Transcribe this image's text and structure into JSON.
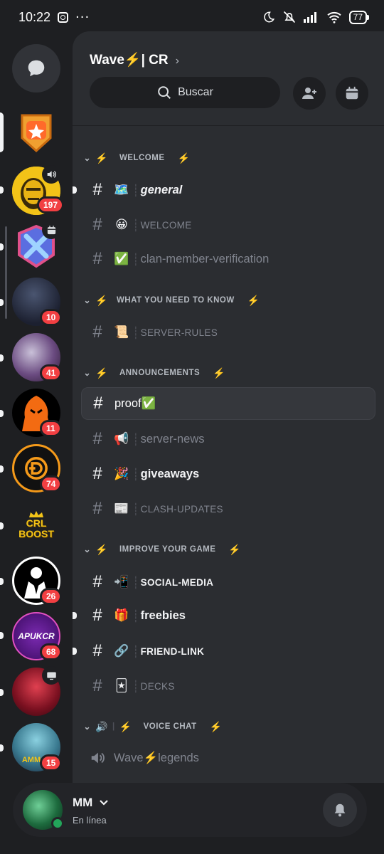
{
  "status_bar": {
    "time": "10:22",
    "more": "···",
    "battery": "77"
  },
  "servers": [
    {
      "kind": "dm",
      "icon": "messages-icon"
    },
    {
      "kind": "server",
      "badge": "",
      "active": true
    },
    {
      "kind": "server",
      "badge": "197",
      "voice": true
    },
    {
      "kind": "server",
      "badge": "",
      "event": true
    },
    {
      "kind": "server",
      "badge": "10"
    },
    {
      "kind": "server",
      "badge": "41"
    },
    {
      "kind": "server",
      "badge": "11"
    },
    {
      "kind": "server",
      "badge": "74"
    },
    {
      "kind": "server",
      "badge": "",
      "logo_text": "CRL BOOST"
    },
    {
      "kind": "server",
      "badge": "26"
    },
    {
      "kind": "server",
      "badge": "68",
      "logo_text": "APUKCR"
    },
    {
      "kind": "server",
      "badge": "",
      "screen": true
    },
    {
      "kind": "server",
      "badge": "15",
      "logo_text": "AMM"
    }
  ],
  "header": {
    "server_name": "Wave⚡| CR",
    "search_label": "Buscar"
  },
  "categories": {
    "welcome": "WELCOME",
    "need_to_know": "WHAT YOU NEED TO KNOW",
    "announcements": "ANNOUNCEMENTS",
    "improve": "IMPROVE YOUR GAME",
    "voice": "VOICE CHAT"
  },
  "channels": {
    "general": {
      "emoji": "🗺️",
      "name": "general"
    },
    "welcome": {
      "emoji": "😀",
      "name": "WELCOME"
    },
    "verification": {
      "emoji": "✅",
      "name": "clan-member-verification"
    },
    "rules": {
      "emoji": "📜",
      "name": "SERVER-RULES"
    },
    "proof": {
      "name": "proof✅"
    },
    "news": {
      "emoji": "📢",
      "name": "server-news"
    },
    "giveaways": {
      "emoji": "🎉",
      "name": "giveaways"
    },
    "clash_updates": {
      "emoji": "📰",
      "name": "CLASH-UPDATES"
    },
    "social": {
      "emoji": "📲",
      "name": "SOCIAL-MEDIA"
    },
    "freebies": {
      "emoji": "🎁",
      "name": "freebies"
    },
    "friend_link": {
      "emoji": "🔗",
      "name": "FRIEND-LINK"
    },
    "decks": {
      "emoji": "🃏",
      "name": "DECKS"
    },
    "voice_legends": {
      "name": "Wave⚡legends"
    }
  },
  "user": {
    "name": "MM",
    "status": "En línea"
  },
  "colors": {
    "background": "#1e1f22",
    "panel": "#2b2d31",
    "badge": "#f23f42",
    "online": "#23a55a",
    "bolt": "#f0b232"
  }
}
